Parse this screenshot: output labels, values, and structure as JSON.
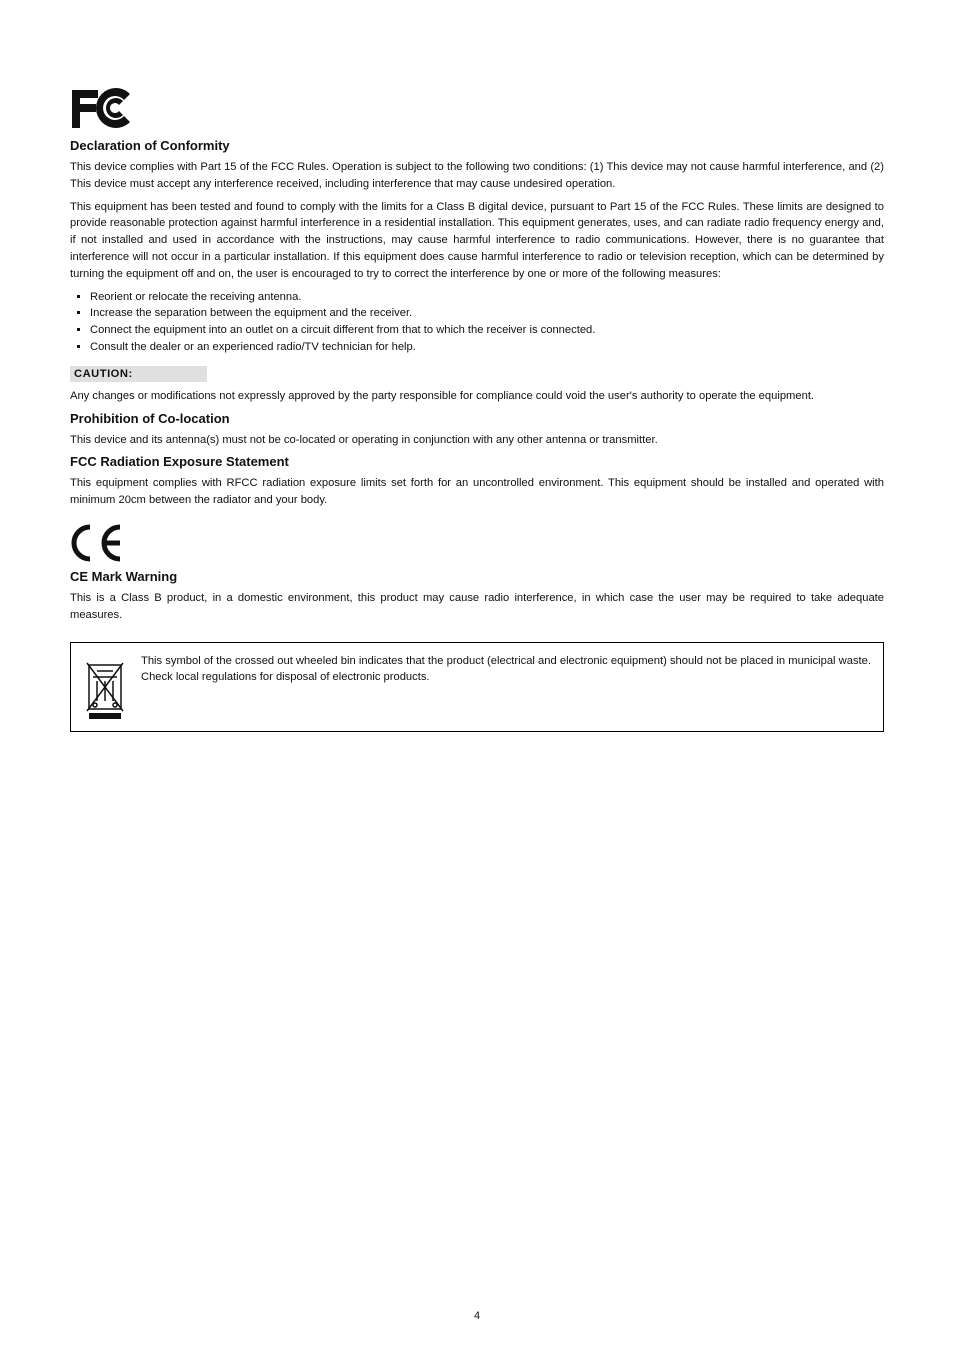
{
  "fcc": {
    "title": "Declaration of Conformity",
    "p1": "This device complies with Part 15 of the FCC Rules. Operation is subject to the following two conditions: (1) This device may not cause harmful interference, and (2) This device must accept any interference received, including interference that may cause undesired operation.",
    "p2": "This equipment has been tested and found to comply with the limits for a Class B digital device, pursuant to Part 15 of the FCC Rules. These limits are designed to provide reasonable protection against harmful interference in a residential installation. This equipment generates, uses, and can radiate radio frequency energy and, if not installed and used in accordance with the instructions, may cause harmful interference to radio communications. However, there is no guarantee that interference will not occur in a particular installation. If this equipment does cause harmful interference to radio or television reception, which can be determined by turning the equipment off and on, the user is encouraged to try to correct the interference by one or more of the following measures:",
    "bullets": [
      "Reorient or relocate the receiving antenna.",
      "Increase the separation between the equipment and the receiver.",
      "Connect the equipment into an outlet on a circuit different from that to which the receiver is connected.",
      "Consult the dealer or an experienced radio/TV technician for help."
    ],
    "caution_label": "CAUTION:",
    "caution_text": "Any changes or modifications not expressly approved by the party responsible for compliance could void the user's authority to operate the equipment.",
    "warning_title": "Prohibition of Co-location",
    "warning_text": "This device and its antenna(s) must not be co-located or operating in conjunction with any other antenna or transmitter.",
    "exposure_title": "FCC Radiation Exposure Statement",
    "exposure_text": "This equipment complies with RFCC radiation exposure limits set forth for an uncontrolled environment. This equipment should be installed and operated with minimum 20cm between the radiator and your body."
  },
  "ce": {
    "title": "CE Mark Warning",
    "text": "This is a Class B product, in a domestic environment, this product may cause radio interference, in which case the user may be required to take adequate measures."
  },
  "weee": {
    "text": "This symbol of the crossed out wheeled bin indicates that the product (electrical and electronic equipment) should not be placed in municipal waste. Check local regulations for disposal of electronic products."
  },
  "page_number": "4"
}
